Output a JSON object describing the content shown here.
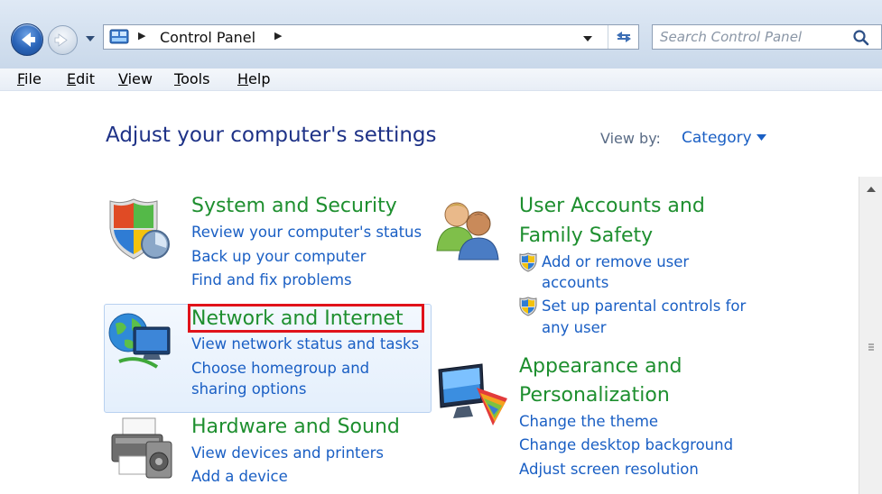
{
  "address_bar": {
    "breadcrumb": "Control Panel",
    "search_placeholder": "Search Control Panel"
  },
  "menu": [
    {
      "label": "File",
      "key": "F",
      "rest": "ile"
    },
    {
      "label": "Edit",
      "key": "E",
      "rest": "dit"
    },
    {
      "label": "View",
      "key": "V",
      "rest": "iew"
    },
    {
      "label": "Tools",
      "key": "T",
      "rest": "ools"
    },
    {
      "label": "Help",
      "key": "H",
      "rest": "elp"
    }
  ],
  "main": {
    "title": "Adjust your computer's settings",
    "view_by_label": "View by:",
    "view_by_value": "Category"
  },
  "categories": {
    "system": {
      "title": "System and Security",
      "links": [
        "Review your computer's status",
        "Back up your computer",
        "Find and fix problems"
      ]
    },
    "network": {
      "title": "Network and Internet",
      "links": [
        "View network status and tasks",
        "Choose homegroup and",
        "sharing options"
      ]
    },
    "hardware": {
      "title": "Hardware and Sound",
      "links": [
        "View devices and printers",
        "Add a device"
      ]
    },
    "users": {
      "title_line1": "User Accounts and",
      "title_line2": "Family Safety",
      "links": [
        "Add or remove user",
        "accounts",
        "Set up parental controls for",
        "any user"
      ]
    },
    "appearance": {
      "title_line1": "Appearance and",
      "title_line2": "Personalization",
      "links": [
        "Change the theme",
        "Change desktop background",
        "Adjust screen resolution"
      ]
    }
  },
  "colors": {
    "category_title": "#1e8f2f",
    "link": "#1a5fc4",
    "page_title": "#1e3287",
    "highlight_border": "#e0121a"
  },
  "icons": [
    "back-arrow-icon",
    "forward-arrow-icon",
    "control-panel-icon",
    "refresh-icon",
    "search-icon",
    "uac-shield-icon"
  ]
}
